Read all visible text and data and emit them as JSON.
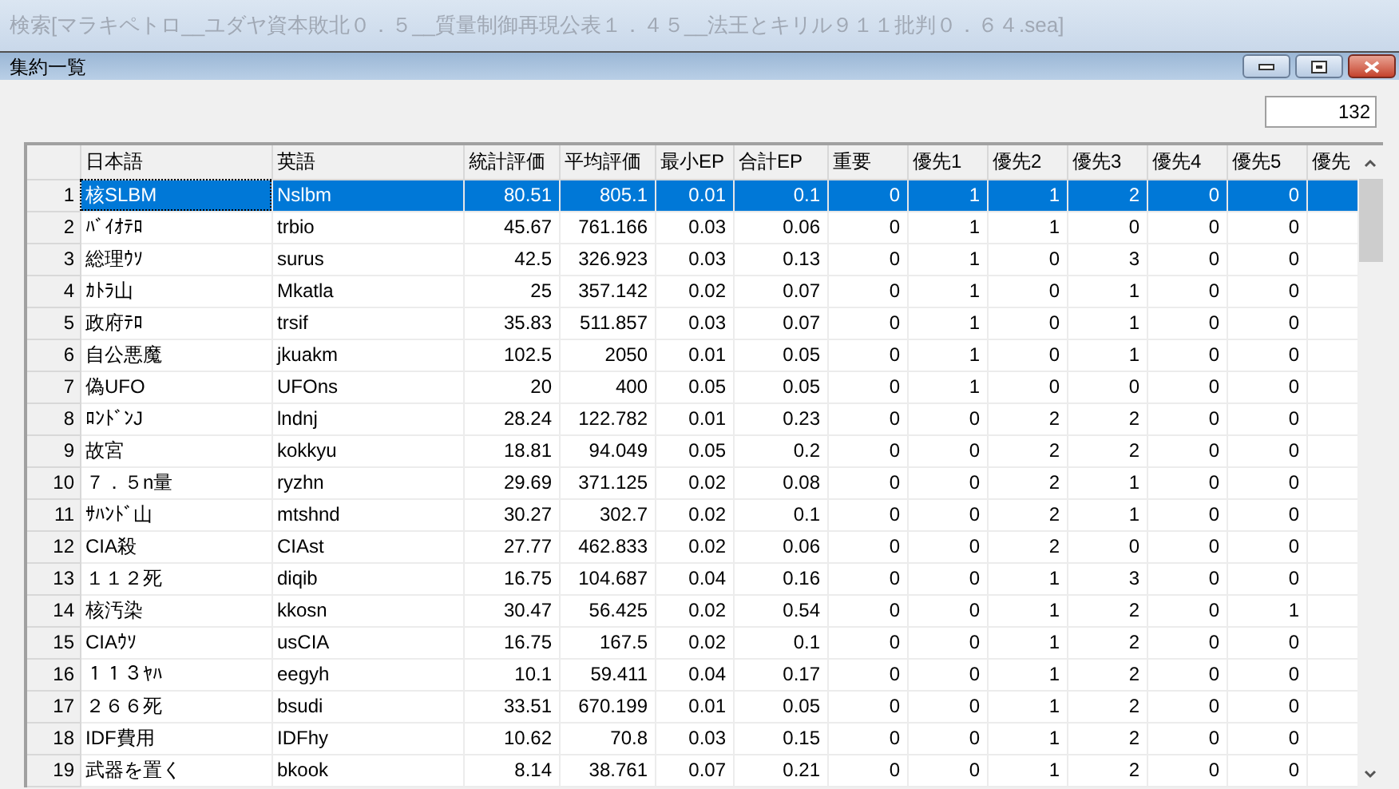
{
  "app_title": "検索[マラキペトロ__ユダヤ資本敗北０．５__質量制御再現公表１．４５__法王とキリル９１１批判０．６４.sea]",
  "window": {
    "title": "集約一覧"
  },
  "count": "132",
  "table": {
    "columns": [
      "日本語",
      "英語",
      "統計評価",
      "平均評価",
      "最小EP",
      "合計EP",
      "重要",
      "優先1",
      "優先2",
      "優先3",
      "優先4",
      "優先5",
      "優先"
    ],
    "rows": [
      {
        "num": "1",
        "selected": true,
        "cells": [
          "核SLBM",
          "Nslbm",
          "80.51",
          "805.1",
          "0.01",
          "0.1",
          "0",
          "1",
          "1",
          "2",
          "0",
          "0"
        ]
      },
      {
        "num": "2",
        "selected": false,
        "cells": [
          "ﾊﾞｲｵﾃﾛ",
          "trbio",
          "45.67",
          "761.166",
          "0.03",
          "0.06",
          "0",
          "1",
          "1",
          "0",
          "0",
          "0"
        ]
      },
      {
        "num": "3",
        "selected": false,
        "cells": [
          "総理ｳｿ",
          "surus",
          "42.5",
          "326.923",
          "0.03",
          "0.13",
          "0",
          "1",
          "0",
          "3",
          "0",
          "0"
        ]
      },
      {
        "num": "4",
        "selected": false,
        "cells": [
          "ｶﾄﾗ山",
          "Mkatla",
          "25",
          "357.142",
          "0.02",
          "0.07",
          "0",
          "1",
          "0",
          "1",
          "0",
          "0"
        ]
      },
      {
        "num": "5",
        "selected": false,
        "cells": [
          "政府ﾃﾛ",
          "trsif",
          "35.83",
          "511.857",
          "0.03",
          "0.07",
          "0",
          "1",
          "0",
          "1",
          "0",
          "0"
        ]
      },
      {
        "num": "6",
        "selected": false,
        "cells": [
          "自公悪魔",
          "jkuakm",
          "102.5",
          "2050",
          "0.01",
          "0.05",
          "0",
          "1",
          "0",
          "1",
          "0",
          "0"
        ]
      },
      {
        "num": "7",
        "selected": false,
        "cells": [
          "偽UFO",
          "UFOns",
          "20",
          "400",
          "0.05",
          "0.05",
          "0",
          "1",
          "0",
          "0",
          "0",
          "0"
        ]
      },
      {
        "num": "8",
        "selected": false,
        "cells": [
          "ﾛﾝﾄﾞﾝJ",
          "lndnj",
          "28.24",
          "122.782",
          "0.01",
          "0.23",
          "0",
          "0",
          "2",
          "2",
          "0",
          "0"
        ]
      },
      {
        "num": "9",
        "selected": false,
        "cells": [
          "故宮",
          "kokkyu",
          "18.81",
          "94.049",
          "0.05",
          "0.2",
          "0",
          "0",
          "2",
          "2",
          "0",
          "0"
        ]
      },
      {
        "num": "10",
        "selected": false,
        "cells": [
          "７．５n量",
          "ryzhn",
          "29.69",
          "371.125",
          "0.02",
          "0.08",
          "0",
          "0",
          "2",
          "1",
          "0",
          "0"
        ]
      },
      {
        "num": "11",
        "selected": false,
        "cells": [
          "ｻﾊﾝﾄﾞ山",
          "mtshnd",
          "30.27",
          "302.7",
          "0.02",
          "0.1",
          "0",
          "0",
          "2",
          "1",
          "0",
          "0"
        ]
      },
      {
        "num": "12",
        "selected": false,
        "cells": [
          "CIA殺",
          "CIAst",
          "27.77",
          "462.833",
          "0.02",
          "0.06",
          "0",
          "0",
          "2",
          "0",
          "0",
          "0"
        ]
      },
      {
        "num": "13",
        "selected": false,
        "cells": [
          "１１２死",
          "diqib",
          "16.75",
          "104.687",
          "0.04",
          "0.16",
          "0",
          "0",
          "1",
          "3",
          "0",
          "0"
        ]
      },
      {
        "num": "14",
        "selected": false,
        "cells": [
          "核汚染",
          "kkosn",
          "30.47",
          "56.425",
          "0.02",
          "0.54",
          "0",
          "0",
          "1",
          "2",
          "0",
          "1"
        ]
      },
      {
        "num": "15",
        "selected": false,
        "cells": [
          "CIAｳｿ",
          "usCIA",
          "16.75",
          "167.5",
          "0.02",
          "0.1",
          "0",
          "0",
          "1",
          "2",
          "0",
          "0"
        ]
      },
      {
        "num": "16",
        "selected": false,
        "cells": [
          "１１３ﾔﾊ",
          "eegyh",
          "10.1",
          "59.411",
          "0.04",
          "0.17",
          "0",
          "0",
          "1",
          "2",
          "0",
          "0"
        ]
      },
      {
        "num": "17",
        "selected": false,
        "cells": [
          "２６６死",
          "bsudi",
          "33.51",
          "670.199",
          "0.01",
          "0.05",
          "0",
          "0",
          "1",
          "2",
          "0",
          "0"
        ]
      },
      {
        "num": "18",
        "selected": false,
        "cells": [
          "IDF費用",
          "IDFhy",
          "10.62",
          "70.8",
          "0.03",
          "0.15",
          "0",
          "0",
          "1",
          "2",
          "0",
          "0"
        ]
      },
      {
        "num": "19",
        "selected": false,
        "cells": [
          "武器を置く",
          "bkook",
          "8.14",
          "38.761",
          "0.07",
          "0.21",
          "0",
          "0",
          "1",
          "2",
          "0",
          "0"
        ]
      }
    ]
  }
}
